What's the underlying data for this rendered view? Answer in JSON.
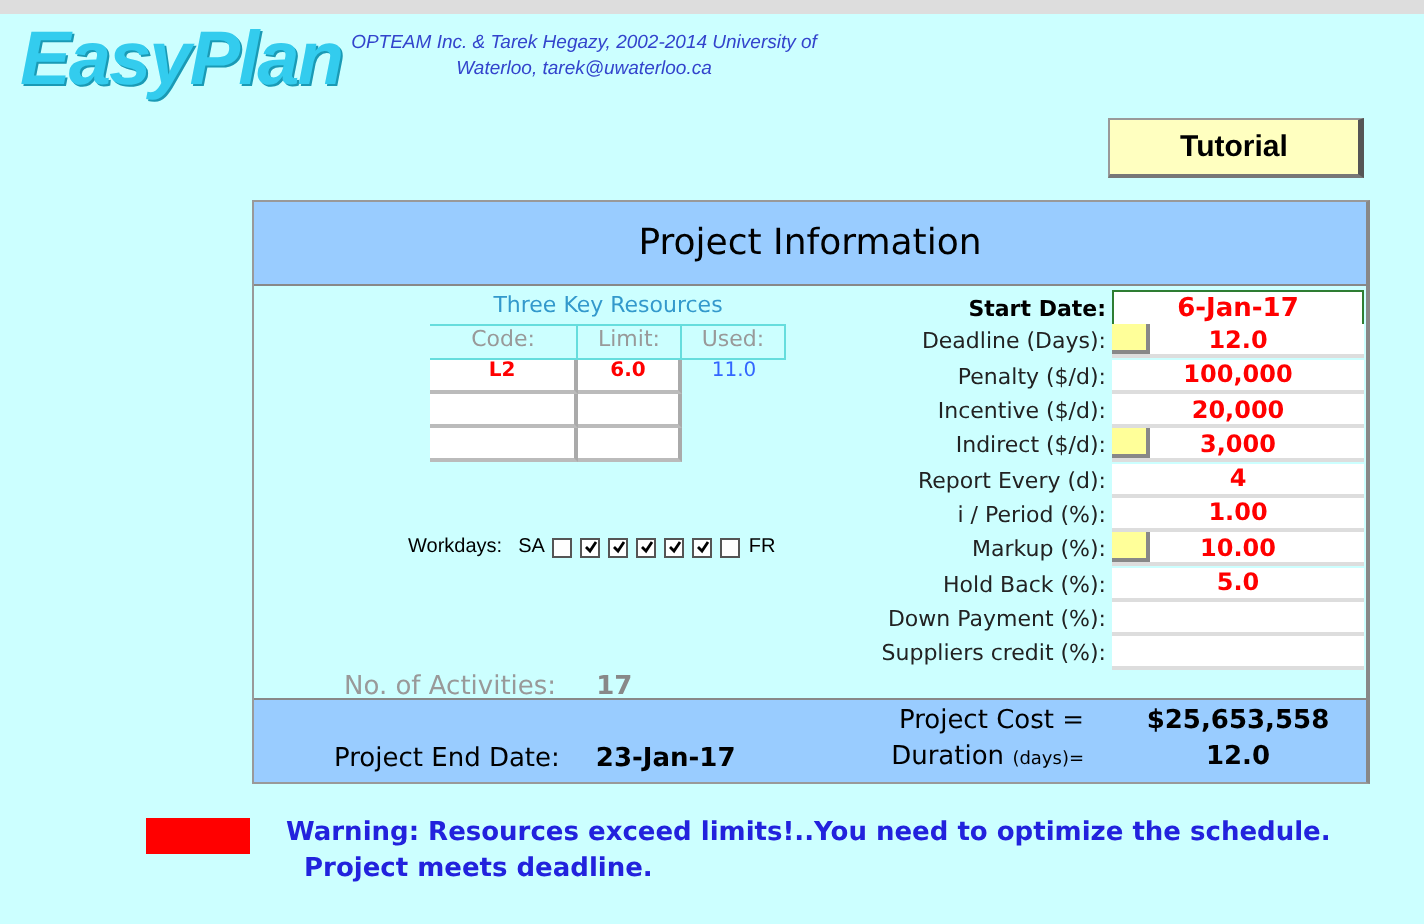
{
  "logo": "EasyPlan",
  "credit": "OPTEAM Inc. & Tarek Hegazy, 2002-2014 University of Waterloo, tarek@uwaterloo.ca",
  "tutorial_button": "Tutorial",
  "title": "Project  Information",
  "resources": {
    "title": "Three Key Resources",
    "columns": [
      "Code:",
      "Limit:",
      "Used:"
    ],
    "rows": [
      {
        "code": "L2",
        "limit": "6.0",
        "used": "11.0"
      },
      {},
      {}
    ]
  },
  "workdays": {
    "label": "Workdays:",
    "first_day": "SA",
    "last_day": "FR",
    "days": [
      {
        "checked": false
      },
      {
        "checked": true
      },
      {
        "checked": true
      },
      {
        "checked": true
      },
      {
        "checked": true
      },
      {
        "checked": true
      },
      {
        "checked": false
      }
    ]
  },
  "activities": {
    "label": "No. of Activities:",
    "value": "17"
  },
  "fields": [
    {
      "label": "Start Date:",
      "value": "6-Jan-17",
      "kind": "date",
      "button": false
    },
    {
      "label": "Deadline (Days):",
      "value": "12.0",
      "kind": "plain",
      "button": true
    },
    {
      "label": "Penalty ($/d):",
      "value": "100,000",
      "kind": "plain",
      "button": false
    },
    {
      "label": "Incentive ($/d):",
      "value": "20,000",
      "kind": "plain",
      "button": false
    },
    {
      "label": "Indirect ($/d):",
      "value": "3,000",
      "kind": "plain",
      "button": true
    },
    {
      "label": "Report Every (d):",
      "value": "4",
      "kind": "plain",
      "button": false
    },
    {
      "label": "i / Period  (%):",
      "value": "1.00",
      "kind": "plain",
      "button": false
    },
    {
      "label": "Markup (%):",
      "value": "10.00",
      "kind": "plain",
      "button": true
    },
    {
      "label": "Hold Back (%):",
      "value": "5.0",
      "kind": "plain",
      "button": false
    },
    {
      "label": "Down Payment (%):",
      "kind": "plain",
      "button": false
    },
    {
      "label": "Suppliers credit (%):",
      "kind": "plain",
      "button": false
    }
  ],
  "end_date": {
    "label": "Project End Date:",
    "value": "23-Jan-17"
  },
  "cost": {
    "label": "Project Cost =",
    "value": "$25,653,558"
  },
  "duration": {
    "label": "Duration",
    "unit": "(days)=",
    "value": "12.0"
  },
  "messages": [
    "Warning:  Resources exceed limits!..You need to optimize the schedule.",
    "Project meets deadline."
  ]
}
